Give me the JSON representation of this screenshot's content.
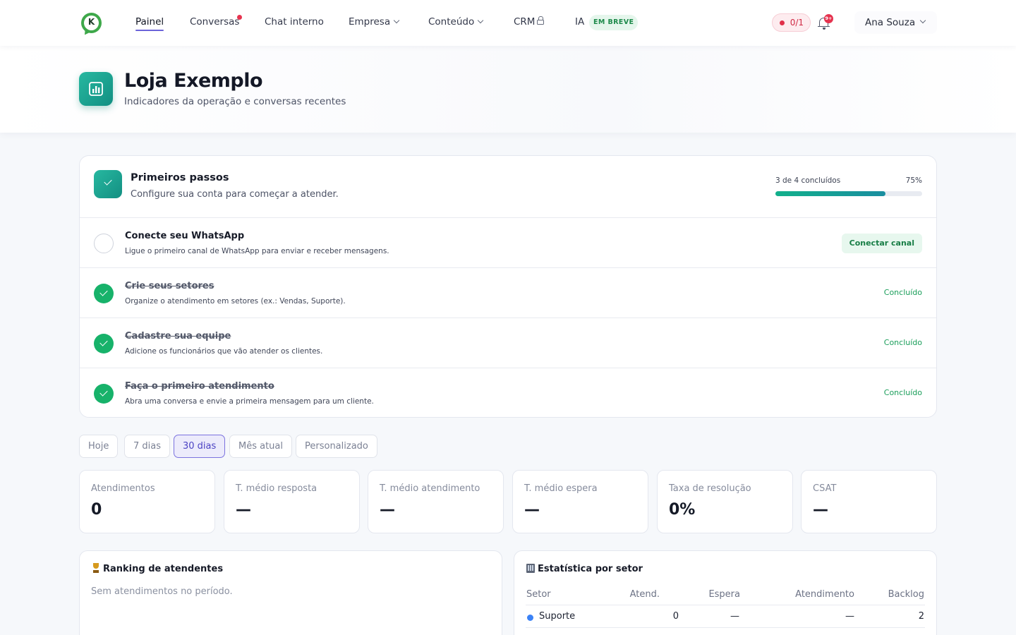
{
  "nav": {
    "logo_letter": "K",
    "items": [
      {
        "label": "Painel"
      },
      {
        "label": "Conversas"
      },
      {
        "label": "Chat interno"
      },
      {
        "label": "Empresa"
      },
      {
        "label": "Conteúdo"
      },
      {
        "label": "CRM"
      },
      {
        "label": "IA"
      }
    ],
    "soon_badge": "EM BREVE",
    "counter": "0/1",
    "notifications": "9+",
    "user_name": "Ana Souza"
  },
  "header": {
    "title": "Loja Exemplo",
    "subtitle": "Indicadores da operação e conversas recentes"
  },
  "onboarding": {
    "title": "Primeiros passos",
    "subtitle": "Configure sua conta para começar a atender.",
    "progress_text": "3 de 4 concluídos",
    "progress_pct": "75%",
    "progress_fraction": 0.75,
    "steps": [
      {
        "title": "Conecte seu WhatsApp",
        "desc": "Ligue o primeiro canal de WhatsApp para enviar e receber mensagens.",
        "action": "Conectar canal",
        "done": false
      },
      {
        "title": "Crie seus setores",
        "desc": "Organize o atendimento em setores (ex.: Vendas, Suporte).",
        "status": "Concluído",
        "done": true
      },
      {
        "title": "Cadastre sua equipe",
        "desc": "Adicione os funcionários que vão atender os clientes.",
        "status": "Concluído",
        "done": true
      },
      {
        "title": "Faça o primeiro atendimento",
        "desc": "Abra uma conversa e envie a primeira mensagem para um cliente.",
        "status": "Concluído",
        "done": true
      }
    ]
  },
  "filters": {
    "options": [
      "Hoje",
      "7 dias",
      "30 dias",
      "Mês atual",
      "Personalizado"
    ],
    "selected": "30 dias"
  },
  "kpis": [
    {
      "label": "Atendimentos",
      "value": "0"
    },
    {
      "label": "T. médio resposta",
      "value": "—"
    },
    {
      "label": "T. médio atendimento",
      "value": "—"
    },
    {
      "label": "T. médio espera",
      "value": "—"
    },
    {
      "label": "Taxa de resolução",
      "value": "0%"
    },
    {
      "label": "CSAT",
      "value": "—"
    }
  ],
  "ranking": {
    "title": "Ranking de atendentes",
    "empty": "Sem atendimentos no período."
  },
  "sectors": {
    "title": "Estatística por setor",
    "columns": [
      "Setor",
      "Atend.",
      "Espera",
      "Atendimento",
      "Backlog"
    ],
    "rows": [
      {
        "name": "Suporte",
        "atend": "0",
        "espera": "—",
        "atendimento": "—",
        "backlog": "2",
        "color": "#3b82f6"
      }
    ]
  },
  "colors": {
    "accent": "#6b63d9",
    "teal": "#1a9e8a",
    "success": "#17b26a",
    "danger": "#e5334f"
  }
}
